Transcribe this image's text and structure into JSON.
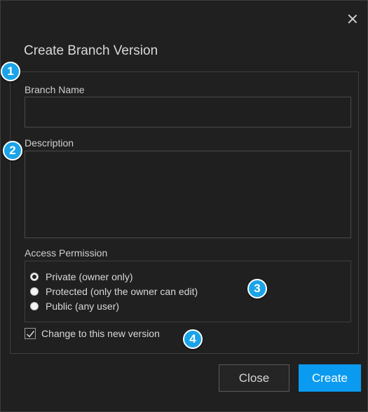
{
  "dialog": {
    "title": "Create Branch Version"
  },
  "form": {
    "branch_name_label": "Branch Name",
    "branch_name_value": "",
    "description_label": "Description",
    "description_value": "",
    "access_permission_label": "Access Permission",
    "access_options": [
      {
        "label": "Private (owner only)",
        "checked": true
      },
      {
        "label": "Protected (only the owner can edit)",
        "checked": false
      },
      {
        "label": "Public (any user)",
        "checked": false
      }
    ],
    "change_version_label": "Change to this new version",
    "change_version_checked": true
  },
  "buttons": {
    "close_label": "Close",
    "create_label": "Create"
  },
  "callouts": [
    "1",
    "2",
    "3",
    "4"
  ],
  "colors": {
    "background": "#202020",
    "accent": "#0a9bf0",
    "callout": "#1aa3e8"
  }
}
